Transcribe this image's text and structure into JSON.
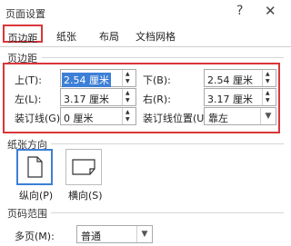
{
  "window": {
    "title": "页面设置",
    "help": "?",
    "close": "✕"
  },
  "tabs": [
    "页边距",
    "纸张",
    "布局",
    "文档网格"
  ],
  "margins": {
    "section_label": "页边距",
    "top": {
      "label": "上(T):",
      "value": "2.54 厘米"
    },
    "bottom": {
      "label": "下(B):",
      "value": "2.54 厘米"
    },
    "left": {
      "label": "左(L):",
      "value": "3.17 厘米"
    },
    "right": {
      "label": "右(R):",
      "value": "3.17 厘米"
    },
    "gutter": {
      "label": "装订线(G):",
      "value": "0 厘米"
    },
    "gutter_position": {
      "label": "装订线位置(U):",
      "value": "靠左"
    }
  },
  "orientation": {
    "section_label": "纸张方向",
    "portrait": {
      "label": "纵向(P)",
      "selected": true
    },
    "landscape": {
      "label": "横向(S)",
      "selected": false
    }
  },
  "pages": {
    "section_label": "页码范围",
    "multiple_label": "多页(M):",
    "multiple_value": "普通"
  },
  "colors": {
    "highlight": "#d9363a",
    "accent": "#3d7fd6"
  }
}
